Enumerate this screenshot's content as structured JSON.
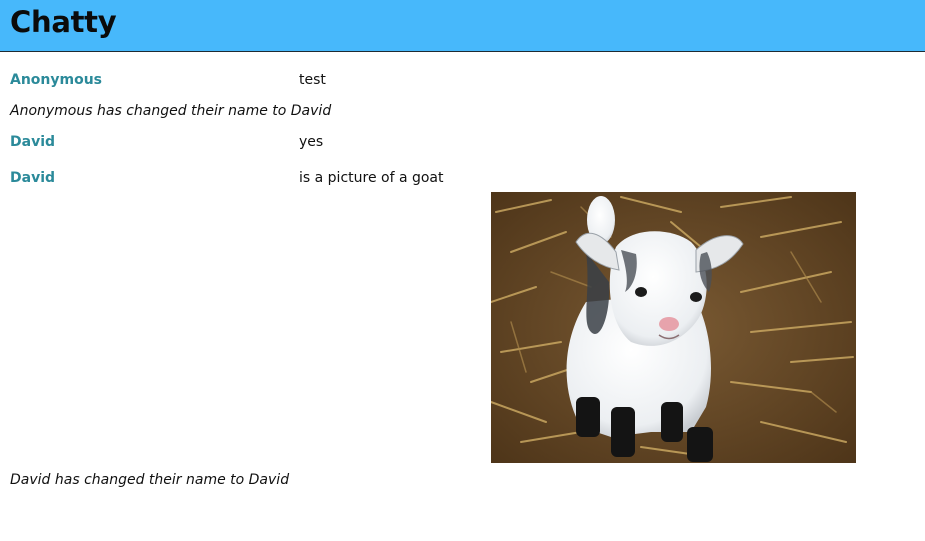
{
  "app": {
    "title": "Chatty"
  },
  "messages": [
    {
      "type": "message",
      "username": "Anonymous",
      "content": "test"
    },
    {
      "type": "system",
      "text": "Anonymous has changed their name to David"
    },
    {
      "type": "message",
      "username": "David",
      "content": "yes"
    },
    {
      "type": "message",
      "username": "David",
      "content": "is a picture of a goat",
      "image": "goat-photo"
    },
    {
      "type": "system",
      "text": "David has changed their name to David"
    }
  ],
  "colors": {
    "navbar": "#47b8fb",
    "username": "#2b8a9a"
  }
}
